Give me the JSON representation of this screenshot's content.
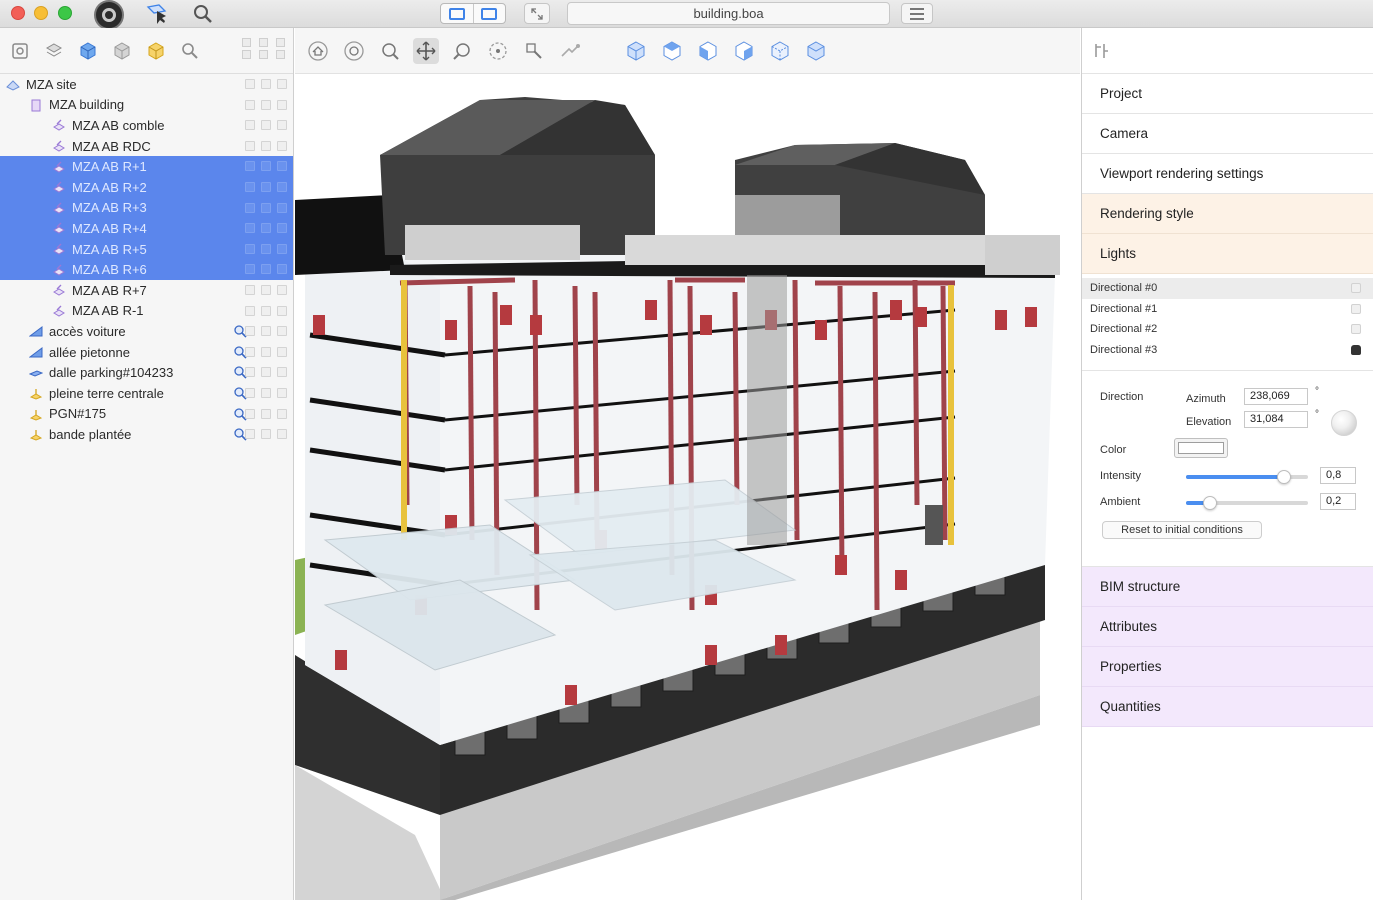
{
  "window": {
    "title": "building.boa"
  },
  "tree": {
    "items": [
      {
        "label": "MZA site",
        "depth": 0,
        "icon": "site-icon",
        "selected": false,
        "search": false
      },
      {
        "label": "MZA building",
        "depth": 1,
        "icon": "building-icon",
        "selected": false,
        "search": false
      },
      {
        "label": "MZA AB comble",
        "depth": 2,
        "icon": "storey-icon",
        "selected": false,
        "search": false
      },
      {
        "label": "MZA AB RDC",
        "depth": 2,
        "icon": "storey-icon",
        "selected": false,
        "search": false
      },
      {
        "label": "MZA AB R+1",
        "depth": 2,
        "icon": "storey-icon",
        "selected": true,
        "search": false
      },
      {
        "label": "MZA AB R+2",
        "depth": 2,
        "icon": "storey-icon",
        "selected": true,
        "search": false
      },
      {
        "label": "MZA AB R+3",
        "depth": 2,
        "icon": "storey-icon",
        "selected": true,
        "search": false
      },
      {
        "label": "MZA AB R+4",
        "depth": 2,
        "icon": "storey-icon",
        "selected": true,
        "search": false
      },
      {
        "label": "MZA AB R+5",
        "depth": 2,
        "icon": "storey-icon",
        "selected": true,
        "search": false
      },
      {
        "label": "MZA AB R+6",
        "depth": 2,
        "icon": "storey-icon",
        "selected": true,
        "search": false
      },
      {
        "label": "MZA AB R+7",
        "depth": 2,
        "icon": "storey-icon",
        "selected": false,
        "search": false
      },
      {
        "label": "MZA AB R-1",
        "depth": 2,
        "icon": "storey-icon",
        "selected": false,
        "search": false
      },
      {
        "label": "accès voiture",
        "depth": 1,
        "icon": "ramp-icon",
        "selected": false,
        "search": true
      },
      {
        "label": "allée pietonne",
        "depth": 1,
        "icon": "ramp-icon",
        "selected": false,
        "search": true
      },
      {
        "label": "dalle parking#104233",
        "depth": 1,
        "icon": "slab-icon",
        "selected": false,
        "search": true
      },
      {
        "label": "pleine terre centrale",
        "depth": 1,
        "icon": "terrain-icon",
        "selected": false,
        "search": true
      },
      {
        "label": "PGN#175",
        "depth": 1,
        "icon": "terrain-icon",
        "selected": false,
        "search": true
      },
      {
        "label": "bande plantée",
        "depth": 1,
        "icon": "terrain-icon",
        "selected": false,
        "search": true
      }
    ]
  },
  "panel": {
    "sections_top": [
      "Project",
      "Camera",
      "Viewport rendering settings",
      "Rendering style",
      "Lights"
    ],
    "sections_bottom": [
      "BIM structure",
      "Attributes",
      "Properties",
      "Quantities"
    ],
    "lights": [
      "Directional #0",
      "Directional #1",
      "Directional #2",
      "Directional #3"
    ],
    "props": {
      "direction_label": "Direction",
      "azimuth_label": "Azimuth",
      "azimuth_value": "238,069",
      "elevation_label": "Elevation",
      "elevation_value": "31,084",
      "degree_symbol": "°",
      "color_label": "Color",
      "intensity_label": "Intensity",
      "intensity_value": "0,8",
      "intensity_level": 0.8,
      "ambient_label": "Ambient",
      "ambient_value": "0,2",
      "ambient_level": 0.2,
      "reset_label": "Reset to initial conditions"
    }
  },
  "colors": {
    "selection": "#5b86ec",
    "accent": "#3f83e8",
    "rendering_style_bg": "#fdf2e6",
    "bim_sections_bg": "#f3e8fc",
    "pipe": "#a0434b",
    "yellow_post": "#e8c23c"
  }
}
